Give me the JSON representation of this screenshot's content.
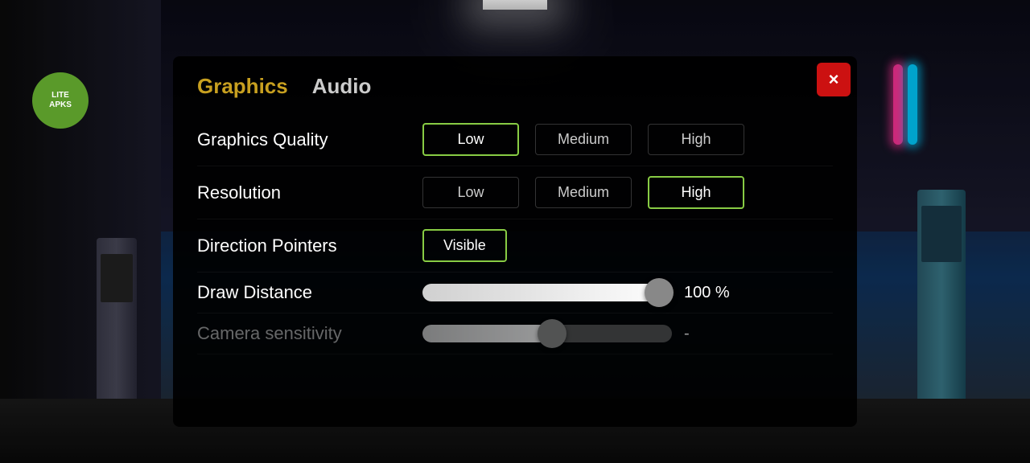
{
  "background": {
    "description": "Gas station parking lot night scene"
  },
  "liteapks": {
    "label": "LITE\nAPKS"
  },
  "dialog": {
    "tabs": [
      {
        "id": "graphics",
        "label": "Graphics",
        "active": true
      },
      {
        "id": "audio",
        "label": "Audio",
        "active": false
      }
    ],
    "close_button_label": "×",
    "settings": [
      {
        "id": "graphics-quality",
        "label": "Graphics Quality",
        "type": "three-way",
        "options": [
          "Low",
          "Medium",
          "High"
        ],
        "selected": "Low"
      },
      {
        "id": "resolution",
        "label": "Resolution",
        "type": "three-way",
        "options": [
          "Low",
          "Medium",
          "High"
        ],
        "selected": "High"
      },
      {
        "id": "direction-pointers",
        "label": "Direction Pointers",
        "type": "toggle",
        "value": "Visible"
      },
      {
        "id": "draw-distance",
        "label": "Draw Distance",
        "type": "slider",
        "value": 100,
        "unit": "%",
        "display_value": "100 %"
      },
      {
        "id": "camera-sensitivity",
        "label": "Camera sensitivity",
        "type": "slider",
        "value": 52,
        "unit": "",
        "display_value": "-"
      }
    ]
  }
}
